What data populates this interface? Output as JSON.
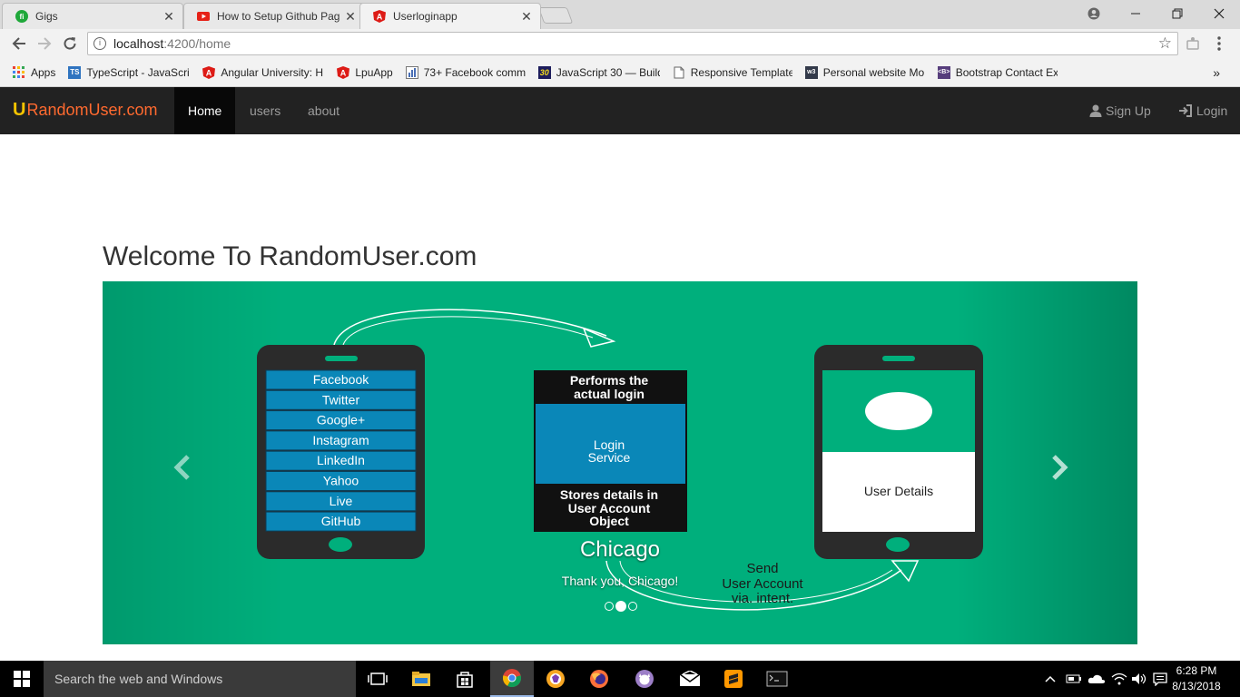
{
  "browser": {
    "tabs": [
      {
        "title": "Gigs",
        "icon": "gigs-icon",
        "active": false
      },
      {
        "title": "How to Setup Github Pag",
        "icon": "youtube-icon",
        "active": false
      },
      {
        "title": "Userloginapp",
        "icon": "angular-icon",
        "active": true
      }
    ],
    "url_host": "localhost",
    "url_path": ":4200/home",
    "bookmarks": [
      {
        "label": "Apps",
        "icon": "apps-grid-icon"
      },
      {
        "label": "TypeScript - JavaScrip",
        "icon": "typescript-icon"
      },
      {
        "label": "Angular University: H",
        "icon": "angular-icon"
      },
      {
        "label": "LpuApp",
        "icon": "angular-icon"
      },
      {
        "label": "73+ Facebook comm",
        "icon": "chart-icon"
      },
      {
        "label": "JavaScript 30 — Build",
        "icon": "js30-icon"
      },
      {
        "label": "Responsive Template",
        "icon": "page-icon"
      },
      {
        "label": "Personal website Mo",
        "icon": "w3-icon"
      },
      {
        "label": "Bootstrap Contact Ex",
        "icon": "bootstrap-icon"
      }
    ],
    "more_bookmarks": "»"
  },
  "navbar": {
    "brand_u": "U",
    "brand_text": "RandomUser.com",
    "links": [
      "Home",
      "users",
      "about"
    ],
    "signup": "Sign Up",
    "login": "Login"
  },
  "main": {
    "heading": "Welcome To RandomUser.com"
  },
  "carousel": {
    "providers": [
      "Facebook",
      "Twitter",
      "Google+",
      "Instagram",
      "LinkedIn",
      "Yahoo",
      "Live",
      "GitHub"
    ],
    "service_top": [
      "Performs the",
      "actual login"
    ],
    "service_mid": [
      "Login",
      "Service"
    ],
    "service_bottom": [
      "Stores details in",
      "User Account",
      "Object"
    ],
    "user_details": "User Details",
    "send_text": [
      "Send",
      "User Account",
      "via. intent."
    ],
    "caption_title": "Chicago",
    "caption_text": "Thank you, Chicago!",
    "active_slide": 2,
    "slide_count": 3
  },
  "taskbar": {
    "search_placeholder": "Search the web and Windows",
    "time": "6:28 PM",
    "date": "8/13/2018"
  },
  "colors": {
    "carousel_bg": "#00af7c",
    "provider_blue": "#0a87b8",
    "brand_orange": "#ff6a2f",
    "brand_yellow": "#f5c400"
  }
}
